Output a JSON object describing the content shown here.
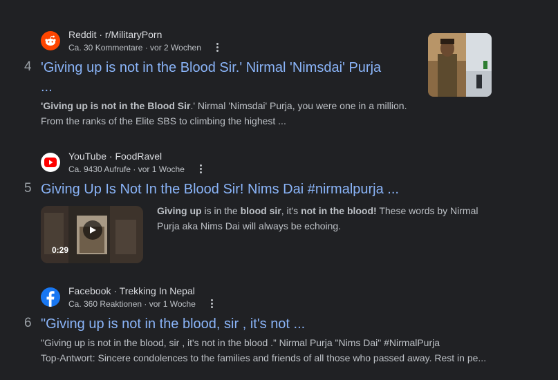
{
  "results": [
    {
      "rank": "4",
      "site": "Reddit · r/MilitaryPorn",
      "meta": "Ca. 30 Kommentare · vor 2 Wochen",
      "title_line1": "'Giving up is not in the Blood Sir.' Nirmal 'Nimsdai' Purja",
      "title_line2": "...",
      "snippet_bold": "'Giving up is not in the Blood Sir",
      "snippet_rest1": ".' Nirmal 'Nimsdai' Purja, you were one in a million.",
      "snippet_line2": "From the ranks of the Elite SBS to climbing the highest ...",
      "favicon": "reddit-icon",
      "brand_color": "#ff4500"
    },
    {
      "rank": "5",
      "site": "YouTube · FoodRavel",
      "meta": "Ca. 9430 Aufrufe · vor 1 Woche",
      "title": "Giving Up Is Not In the Blood Sir! Nims Dai #nirmalpurja ...",
      "snippet_b1": "Giving up",
      "snippet_t1": " is in the ",
      "snippet_b2": "blood sir",
      "snippet_t2": ", it's ",
      "snippet_b3": "not in the blood!",
      "snippet_t3": " These words by Nirmal",
      "snippet_line2": "Purja aka Nims Dai will always be echoing.",
      "duration": "0:29",
      "favicon": "youtube-icon",
      "brand_color": "#ff0000"
    },
    {
      "rank": "6",
      "site": "Facebook · Trekking In Nepal",
      "meta": "Ca. 360 Reaktionen · vor 1 Woche",
      "title": "\"Giving up is not in the blood, sir , it's not ...",
      "snippet_line1": "\"Giving up is not in the blood, sir , it's not in the blood .” Nirmal Purja \"Nims Dai\" #NirmalPurja",
      "snippet_line2": "Top-Antwort: Sincere condolences to the families and friends of all those who passed away. Rest in pe...",
      "favicon": "facebook-icon",
      "brand_color": "#1877f2"
    }
  ]
}
